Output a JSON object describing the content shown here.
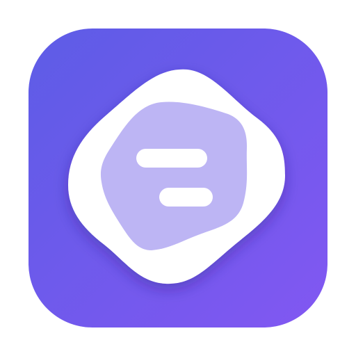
{
  "app_icon": {
    "icon_name": "notes-menu-icon",
    "colors": {
      "gradient_start": "#5D5CE6",
      "gradient_end": "#8257F2",
      "blob_outer": "#FFFFFF",
      "blob_inner": "#BDB5F4",
      "bar": "#FFFFFF"
    }
  }
}
